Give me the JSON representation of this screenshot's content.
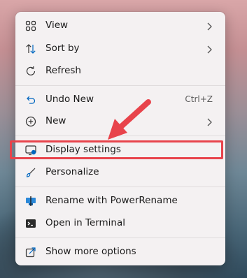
{
  "menu": {
    "items": [
      {
        "label": "View",
        "icon": "grid-icon",
        "has_submenu": true
      },
      {
        "label": "Sort by",
        "icon": "sort-arrows-icon",
        "has_submenu": true
      },
      {
        "label": "Refresh",
        "icon": "refresh-icon",
        "has_submenu": false
      },
      {
        "label": "Undo New",
        "icon": "undo-icon",
        "shortcut": "Ctrl+Z"
      },
      {
        "label": "New",
        "icon": "plus-circle-icon",
        "has_submenu": true
      },
      {
        "label": "Display settings",
        "icon": "display-settings-icon"
      },
      {
        "label": "Personalize",
        "icon": "brush-icon"
      },
      {
        "label": "Rename with PowerRename",
        "icon": "powerrename-icon"
      },
      {
        "label": "Open in Terminal",
        "icon": "terminal-icon"
      },
      {
        "label": "Show more options",
        "icon": "show-more-icon"
      }
    ]
  },
  "annotation": {
    "highlight_color": "#e8434b",
    "target": "Display settings"
  },
  "colors": {
    "accent": "#0067c0",
    "menu_bg": "#f4f1f2"
  }
}
